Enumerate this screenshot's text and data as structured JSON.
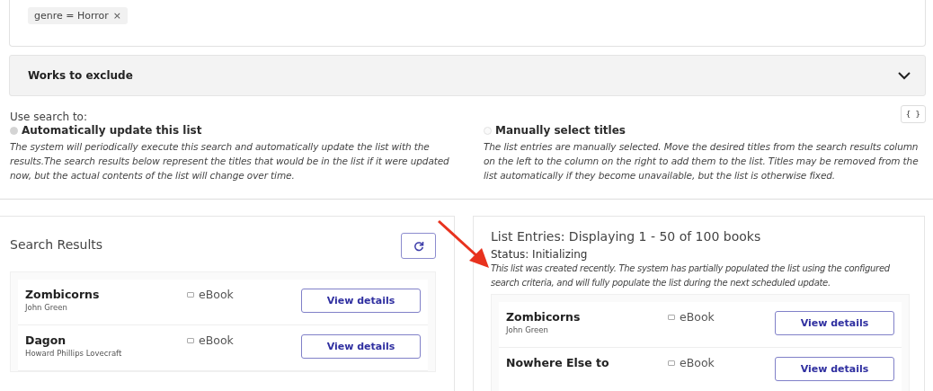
{
  "filter_chips": [
    {
      "label": "genre = Horror",
      "remove": "×"
    }
  ],
  "accordion": {
    "title": "Works to exclude",
    "expanded": false
  },
  "json_button": {
    "label": "{ }"
  },
  "search_mode": {
    "label": "Use search to:",
    "options": [
      {
        "label": "Automatically update this list",
        "selected": true,
        "disabled": true,
        "description": "The system will periodically execute this search and automatically update the list with the results.The search results below represent the titles that would be in the list if it were updated now, but the actual contents of the list will change over time."
      },
      {
        "label": "Manually select titles",
        "selected": false,
        "disabled": true,
        "description": "The list entries are manually selected. Move the desired titles from the search results column on the left to the column on the right to add them to the list. Titles may be removed from the list automatically if they become unavailable, but the list is otherwise fixed."
      }
    ]
  },
  "search_results": {
    "title": "Search Results",
    "rows": [
      {
        "title": "Zombicorns",
        "author": "John Green",
        "format": "eBook",
        "button": "View details"
      },
      {
        "title": "Dagon",
        "author": "Howard Phillips Lovecraft",
        "format": "eBook",
        "button": "View details"
      }
    ]
  },
  "list_entries": {
    "title": "List Entries: Displaying 1 - 50 of 100 books",
    "status": "Status: Initializing",
    "note": "This list was created recently. The system has partially populated the list using the configured search criteria, and will fully populate the list during the next scheduled update.",
    "rows": [
      {
        "title": "Zombicorns",
        "author": "John Green",
        "format": "eBook",
        "button": "View details"
      },
      {
        "title": "Nowhere Else to",
        "author": "",
        "format": "eBook",
        "button": "View details"
      }
    ]
  }
}
